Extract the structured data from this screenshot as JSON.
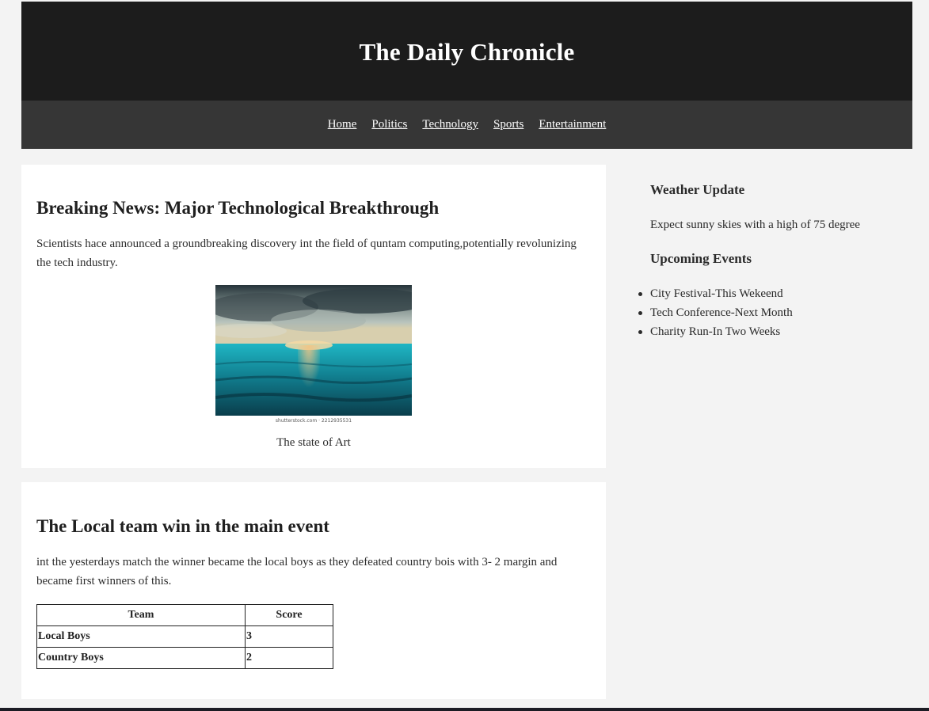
{
  "site": {
    "title": "The Daily Chronicle"
  },
  "nav": [
    "Home",
    "Politics",
    "Technology",
    "Sports",
    "Entertainment"
  ],
  "articles": [
    {
      "headline": "Breaking News: Major Technological Breakthrough",
      "body": "Scientists hace announced a groundbreaking discovery int the field of quntam computing,potentially revolunizing the tech industry.",
      "image": {
        "credit": "shutterstock.com · 2212935531",
        "caption": "The state of Art"
      }
    },
    {
      "headline": "The Local team win in the main event",
      "body": "int the yesterdays match the winner became the local boys as they defeated country bois with 3- 2 margin and became first winners of this.",
      "table": {
        "headers": [
          "Team",
          "Score"
        ],
        "rows": [
          [
            "Local Boys",
            "3"
          ],
          [
            "Country Boys",
            "2"
          ]
        ]
      }
    }
  ],
  "sidebar": {
    "weather_title": "Weather Update",
    "weather_text": "Expect sunny skies with a high of 75 degree",
    "events_title": "Upcoming Events",
    "events": [
      "City Festival-This Wekeend",
      "Tech Conference-Next Month",
      "Charity Run-In Two Weeks"
    ]
  },
  "colors": {
    "masthead": "#1c1c1c",
    "navbar": "#363636",
    "background": "#f3f3f3"
  }
}
